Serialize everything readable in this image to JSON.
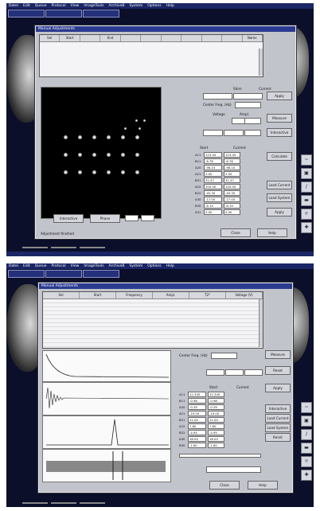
{
  "shotA": {
    "menu": [
      "Datei",
      "Edit",
      "Queue",
      "Protocol",
      "View",
      "ImageTools",
      "ArchiveB",
      "System",
      "Options",
      "Help"
    ],
    "tabs": [
      "",
      "",
      ""
    ],
    "dialog_title": "Manual Adjustments",
    "table_headers": [
      "Sel",
      "Start",
      "",
      "End",
      "",
      "",
      "",
      "",
      "",
      "",
      "Name"
    ],
    "labels": {
      "shim_header": "Shim",
      "shim_current": "Current",
      "freq_label": "Center Freq. (Hz)",
      "voltage": "Voltage",
      "ampl": "Ampl.",
      "params_header_a": "Start",
      "params_header_b": "Current",
      "footer": "Adjustment finished"
    },
    "params": [
      {
        "n": "A11",
        "v": "123.45",
        "u": "123.45"
      },
      {
        "n": "B11",
        "v": "-6.78",
        "u": "-6.78"
      },
      {
        "n": "A20",
        "v": "-98.10",
        "u": "-98.10"
      },
      {
        "n": "A21",
        "v": "2.00",
        "u": "2.00"
      },
      {
        "n": "B21",
        "v": "31.47",
        "u": "31.47"
      },
      {
        "n": "A22",
        "v": "100.00",
        "u": "100.00"
      },
      {
        "n": "B22",
        "v": "-45.30",
        "u": "-45.30"
      },
      {
        "n": "A30",
        "v": "-17.00",
        "u": "-17.00"
      },
      {
        "n": "B30",
        "v": "-6.19",
        "u": "-6.19"
      },
      {
        "n": "A31",
        "v": "0.00",
        "u": "0.00"
      }
    ],
    "buttons": {
      "apply": "Apply",
      "measure": "Measure",
      "interactive": "Interactive",
      "calculate": "Calculate",
      "load_current": "Load Current",
      "load_system": "Load System",
      "apply2": "Apply",
      "close": "Close",
      "help": "Help",
      "prev": "Interactive",
      "phase": "Phase"
    },
    "taskbar": [
      "",
      "",
      ""
    ],
    "status": [
      "",
      "",
      "",
      ""
    ]
  },
  "shotB": {
    "menu": [
      "Datei",
      "Edit",
      "Queue",
      "Protocol",
      "View",
      "ImageTools",
      "ArchiveB",
      "System",
      "Options",
      "Help"
    ],
    "tabs": [
      "",
      "",
      ""
    ],
    "dialog_title": "Manual Adjustments",
    "table_headers": [
      "Sel",
      "Start",
      "Frequency",
      "Ampl.",
      "T2*",
      "Voltage (V)"
    ],
    "rows": 12,
    "labels": {
      "freq_label": "Center Freq. (Hz)",
      "shim_header": "Start",
      "shim_current": "Current",
      "result": ""
    },
    "params": [
      {
        "n": "A11",
        "v": "12.345",
        "u": "12.345"
      },
      {
        "n": "B11",
        "v": "-0.98",
        "u": "-0.98"
      },
      {
        "n": "A20",
        "v": "-0.39",
        "u": "-0.39"
      },
      {
        "n": "A21",
        "v": "-19.00",
        "u": "-19.00"
      },
      {
        "n": "B21",
        "v": "21.00",
        "u": "21.00"
      },
      {
        "n": "A22",
        "v": "7.80",
        "u": "7.80"
      },
      {
        "n": "B22",
        "v": "-4.95",
        "u": "-4.95"
      },
      {
        "n": "A30",
        "v": "18.00",
        "u": "18.00"
      },
      {
        "n": "B30",
        "v": "-1.60",
        "u": "-1.60"
      }
    ],
    "buttons": {
      "measure": "Measure",
      "reset": "Reset",
      "apply": "Apply",
      "interactive": "Interactive",
      "load_current": "Load Current",
      "load_system": "Load System",
      "reinit": "Reinit",
      "close": "Close",
      "help": "Help"
    },
    "taskbar": [
      "",
      "",
      ""
    ]
  }
}
